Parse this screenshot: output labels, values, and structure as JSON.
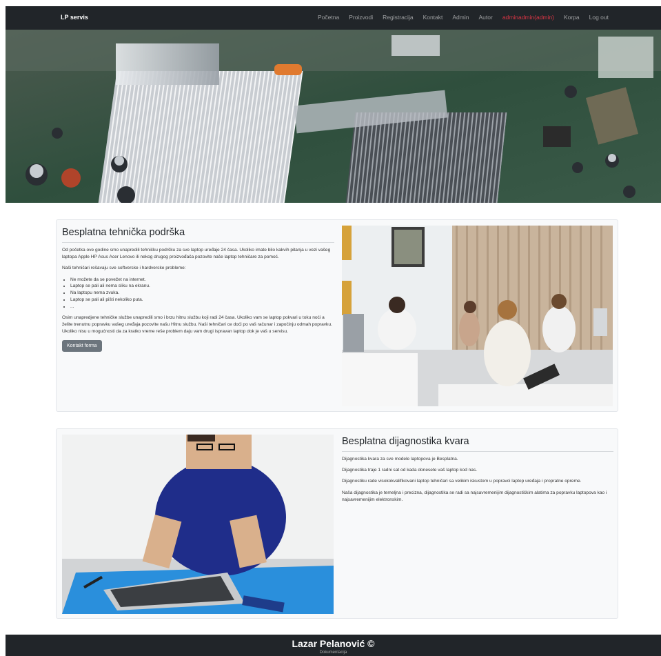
{
  "nav": {
    "brand": "LP servis",
    "links": [
      "Početna",
      "Proizvodi",
      "Registracija",
      "Kontakt",
      "Admin",
      "Autor"
    ],
    "user": "adminadmin(admin)",
    "cart": "Korpa",
    "logout": "Log out"
  },
  "support": {
    "title": "Besplatna tehnička podrška",
    "intro": "Od početka ove godine smo unapredili tehničku podršku za sve laptop uređaje 24 časa. Ukoliko imate bilo kakvih pitanja u vezi vašeg laptopa Apple HP Asus Acer Lenovo ili nekog drugog proizvođača pozovite naše laptop tehničare za pomoć.",
    "lead": "Naši tehničari rešavaju sve softverske i hardverske probleme:",
    "bullets": [
      "Ne možete da se povežet na internet.",
      "Laptop se pali ali nema sliku na ekranu.",
      "Na laptopu nema zvuka.",
      "Laptop se pali ali pišti nekoliko puta.",
      "..."
    ],
    "body": "Osim unapredjene tehničke službe unapredili smo i brzu hitnu službu koji radi 24 časa. Ukoliko vam se laptop pokvari u toku noći a želite trenutnu popravku vašeg uređaja pozovite našu Hitnu službu. Naši tehničari ce doći po vaš računar i započinju odmah popravku. Ukoliko nisu u mogućnosti da za kratko vreme reše problem daju vam drugi ispravan laptop dok je vaš u servisu.",
    "button": "Kontakt forma"
  },
  "diagnostics": {
    "title": "Besplatna dijagnostika kvara",
    "paragraphs": [
      "Dijagnostika kvara za sve modele laptopova je Besplatna.",
      "Dijagnostika traje 1 radni sat od kada donesete vaš laptop kod nas.",
      "Dijagnostiku rade visokokvalifikovani laptop tehničari sa velikim iskustom u popravci laptop uređaja i propratne opreme.",
      "Naša dijagnostika je temeljna i precizna, dijagnostika se radi sa najsavremenijim dijagnostičkim alatima za popravku laptopova kao i najsavremenijim elektronskim."
    ]
  },
  "footer": {
    "title": "Lazar Pelanović ©",
    "link": "Dokumentacija"
  }
}
